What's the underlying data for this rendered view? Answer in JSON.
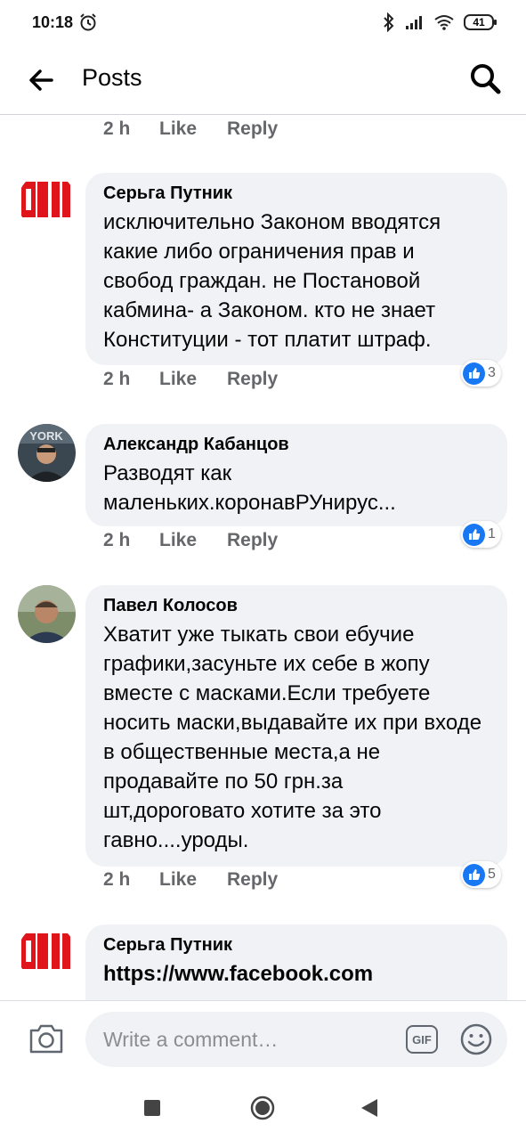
{
  "status_bar": {
    "time": "10:18",
    "battery": "41"
  },
  "header": {
    "title": "Posts"
  },
  "actions": {
    "like": "Like",
    "reply": "Reply"
  },
  "top_meta": {
    "time": "2 h"
  },
  "comments": [
    {
      "author": "Серьга Путник",
      "text": "исключительно Законом вводятся какие либо ограничения прав и свобод граждан. не Постановой кабмина- а Законом. кто не знает Конституции - тот платит штраф.",
      "time": "2 h",
      "reactions": "3"
    },
    {
      "author": "Александр Кабанцов",
      "text": "Разводят как маленьких.коронавРУнирус...",
      "time": "2 h",
      "reactions": "1"
    },
    {
      "author": "Павел Колосов",
      "text": "Хватит уже тыкать свои ебучие графики,засуньте их себе в жопу вместе с масками.Если требуете носить маски,выдавайте их при входе в общественные места,а не продавайте по 50 грн.за шт,дороговато хотите за это гавно....уроды.",
      "time": "2 h",
      "reactions": "5"
    },
    {
      "author": "Серьга Путник",
      "link": "https://www.facebook.com"
    }
  ],
  "composer": {
    "placeholder": "Write a comment…",
    "gif": "GIF"
  },
  "icons": {
    "back": "arrow-left-icon",
    "search": "search-icon",
    "camera": "camera-icon",
    "emoji": "emoji-icon",
    "like_reaction": "thumbs-up-icon"
  },
  "colors": {
    "accent": "#1877f2",
    "bubble": "#f0f2f5",
    "meta": "#65676b"
  }
}
